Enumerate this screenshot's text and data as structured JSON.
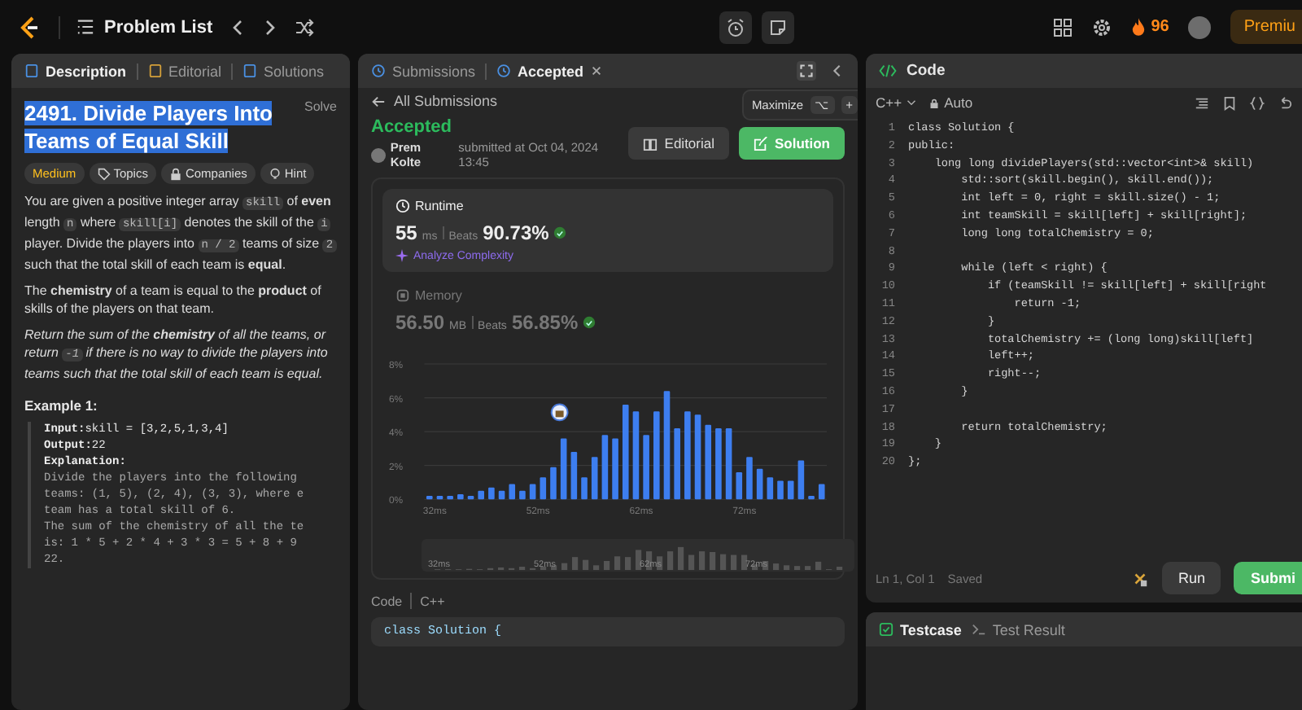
{
  "top_bar": {
    "title": "Problem List",
    "streak": "96",
    "premium": "Premiu"
  },
  "description_panel": {
    "tabs": [
      {
        "label": "Description",
        "selected": true
      },
      {
        "label": "Editorial",
        "selected": false
      },
      {
        "label": "Solutions",
        "selected": false
      }
    ],
    "title": "2491. Divide Players Into Teams of Equal Skill",
    "title_selected": true,
    "status": "Solve",
    "tags": [
      {
        "label": "Medium",
        "kind": "difficulty"
      },
      {
        "label": "Topics",
        "kind": "tag"
      },
      {
        "label": "Companies",
        "kind": "lock"
      },
      {
        "label": "Hint",
        "kind": "bulb"
      }
    ],
    "paragraphs": [
      {
        "italic": false,
        "segments": [
          {
            "kind": "text",
            "text": "You are given a positive integer array "
          },
          {
            "kind": "code",
            "text": "skill"
          },
          {
            "kind": "text",
            "text": " of **even** length "
          },
          {
            "kind": "code",
            "text": "n"
          },
          {
            "kind": "text",
            "text": " where "
          },
          {
            "kind": "code",
            "text": "skill[i]"
          },
          {
            "kind": "text",
            "text": " denotes the skill of the "
          },
          {
            "kind": "code",
            "text": "i"
          },
          {
            "kind": "text",
            "text": " player. Divide the players into "
          },
          {
            "kind": "code",
            "text": "n / 2"
          },
          {
            "kind": "text",
            "text": " teams of size "
          },
          {
            "kind": "code",
            "text": "2"
          },
          {
            "kind": "text",
            "text": " such that the total skill of each team is **equal**."
          }
        ]
      },
      {
        "italic": false,
        "segments": [
          {
            "kind": "text",
            "text": "The **chemistry** of a team is equal to the **product** of skills of the players on that team."
          }
        ]
      },
      {
        "italic": true,
        "segments": [
          {
            "kind": "text",
            "text": "Return the sum of the **chemistry** of all the teams, or return "
          },
          {
            "kind": "code",
            "text": "-1"
          },
          {
            "kind": "text",
            "text": " if there is no way to divide the players into teams such that the total skill of each team is equal."
          }
        ]
      }
    ],
    "example": {
      "heading": "Example 1:",
      "lines": [
        {
          "label": "Input:",
          "text": "skill = [3,2,5,1,3,4]"
        },
        {
          "label": "Output:",
          "text": "22"
        },
        {
          "label": "Explanation:"
        },
        {
          "text": "Divide the players into the following"
        },
        {
          "text": "teams: (1, 5), (2, 4), (3, 3), where e"
        },
        {
          "text": "team has a total skill of 6."
        },
        {
          "text": "The sum of the chemistry of all the te"
        },
        {
          "text": "is: 1 * 5 + 2 * 4 + 3 * 3 = 5 + 8 + 9"
        },
        {
          "text": "22."
        }
      ]
    }
  },
  "submission_panel": {
    "tabs": [
      {
        "label": "Submissions",
        "selected": false,
        "closable": false
      },
      {
        "label": "Accepted",
        "selected": true,
        "closable": true
      }
    ],
    "tooltip": {
      "label": "Maximize",
      "keys": [
        "⌥",
        "+"
      ]
    },
    "back_link": "All Submissions",
    "status": "Accepted",
    "author": "Prem Kolte",
    "submitted": "submitted at Oct 04, 2024 13:45",
    "buttons": [
      {
        "label": "Editorial",
        "kind": "secondary"
      },
      {
        "label": "Solution",
        "kind": "primary"
      }
    ],
    "metrics": [
      {
        "kind": "runtime",
        "label": "Runtime",
        "value": "55",
        "unit": "ms",
        "beats_label": "Beats",
        "beats": "90.73%",
        "selected": true,
        "link": "Analyze Complexity"
      },
      {
        "kind": "memory",
        "label": "Memory",
        "value": "56.50",
        "unit": "MB",
        "beats_label": "Beats",
        "beats": "56.85%",
        "selected": false
      }
    ],
    "chart_data": {
      "type": "bar",
      "categories": [
        "32ms",
        null,
        null,
        null,
        null,
        null,
        null,
        null,
        null,
        null,
        "52ms",
        null,
        null,
        null,
        null,
        null,
        null,
        null,
        null,
        null,
        "62ms",
        null,
        null,
        null,
        null,
        null,
        null,
        null,
        null,
        null,
        "72ms",
        null,
        null,
        null,
        null,
        null,
        null,
        null,
        null
      ],
      "values": [
        0.2,
        0.2,
        0.2,
        0.3,
        0.2,
        0.5,
        0.7,
        0.5,
        0.9,
        0.5,
        0.9,
        1.3,
        1.9,
        3.6,
        2.8,
        1.3,
        2.5,
        3.8,
        3.6,
        5.6,
        5.2,
        3.8,
        5.2,
        6.4,
        4.2,
        5.2,
        5.0,
        4.4,
        4.2,
        4.2,
        1.6,
        2.5,
        1.8,
        1.3,
        1.1,
        1.1,
        2.3,
        0.2,
        0.9
      ],
      "ylim": [
        0,
        8
      ],
      "yticks": [
        {
          "value": 0,
          "label": "0%"
        },
        {
          "value": 2,
          "label": "2%"
        },
        {
          "value": 4,
          "label": "4%"
        },
        {
          "value": 6,
          "label": "6%"
        },
        {
          "value": 8,
          "label": "8%"
        }
      ],
      "grid": true
    },
    "overview_labels": [
      "32ms",
      "52ms",
      "62ms",
      "72ms"
    ],
    "code_header": {
      "label": "Code",
      "language": "C++"
    },
    "code_preview": [
      "class Solution {"
    ]
  },
  "editor": {
    "title": "Code",
    "language": "C++",
    "mode": "Auto",
    "lines": [
      {
        "number": "1",
        "text": "class Solution {"
      },
      {
        "number": "2",
        "text": "public:"
      },
      {
        "number": "3",
        "text": "    long long dividePlayers(std::vector<int>& skill)"
      },
      {
        "number": "4",
        "text": "        std::sort(skill.begin(), skill.end());"
      },
      {
        "number": "5",
        "text": "        int left = 0, right = skill.size() - 1;"
      },
      {
        "number": "6",
        "text": "        int teamSkill = skill[left] + skill[right];"
      },
      {
        "number": "7",
        "text": "        long long totalChemistry = 0;"
      },
      {
        "number": "8"
      },
      {
        "number": "9",
        "text": "        while (left < right) {"
      },
      {
        "number": "10",
        "text": "            if (teamSkill != skill[left] + skill[right"
      },
      {
        "number": "11",
        "text": "                return -1;"
      },
      {
        "number": "12",
        "text": "            }"
      },
      {
        "number": "13",
        "text": "            totalChemistry += (long long)skill[left]"
      },
      {
        "number": "14",
        "text": "            left++;"
      },
      {
        "number": "15",
        "text": "            right--;"
      },
      {
        "number": "16",
        "text": "        }"
      },
      {
        "number": "17"
      },
      {
        "number": "18",
        "text": "        return totalChemistry;"
      },
      {
        "number": "19",
        "text": "    }"
      },
      {
        "number": "20",
        "text": "};"
      }
    ],
    "status": "Ln 1, Col 1",
    "saved": "Saved",
    "run": "Run",
    "submit": "Submi"
  },
  "console": {
    "tabs": [
      {
        "label": "Testcase",
        "selected": true
      },
      {
        "label": "Test Result",
        "selected": false
      }
    ]
  }
}
